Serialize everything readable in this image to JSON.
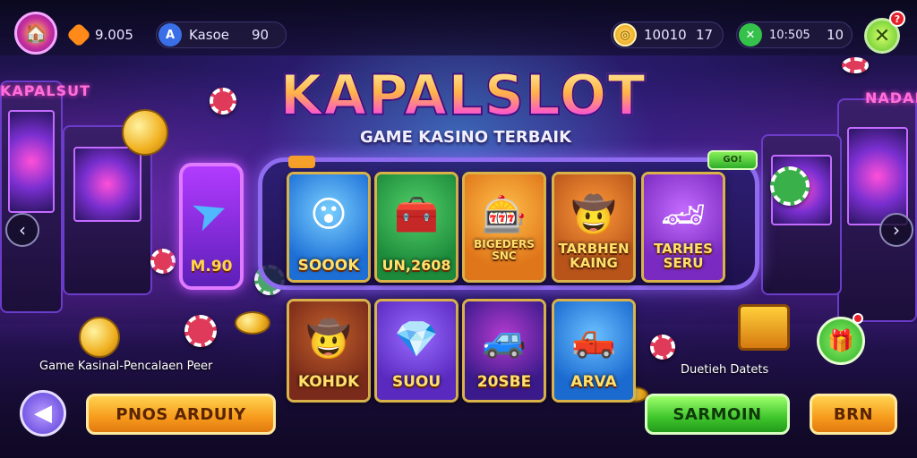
{
  "topbar": {
    "level_value": "9.005",
    "name_value": "Kasoe",
    "name_extra": "90",
    "coins_value": "10010",
    "coins_extra": "17",
    "cash_value": "10:505",
    "cash_extra": "10",
    "notification_count": "?"
  },
  "logo": {
    "title": "KAPALSLOT",
    "subtitle": "GAME KASINO TERBAIK"
  },
  "promo": {
    "value": "M.90"
  },
  "frame_tag_right": "GO!",
  "games_row1": [
    {
      "label": "SOOOK",
      "icon": "character-icon",
      "glyph": "😮",
      "bg": "#1d6fd6",
      "bg2": "#7ad0ff"
    },
    {
      "label": "UN,2608",
      "icon": "chest-icon",
      "glyph": "🧰",
      "bg": "#1c8a3a",
      "bg2": "#53d06a"
    },
    {
      "label": "BIGEDERS SNC",
      "icon": "slot-reel-icon",
      "glyph": "🎰",
      "bg": "#e0761a",
      "bg2": "#ffc04a"
    },
    {
      "label": "TARBHEN KAING",
      "icon": "pirate-icon",
      "glyph": "🤠",
      "bg": "#b8541a",
      "bg2": "#ff9a3a"
    },
    {
      "label": "TARHES SERU",
      "icon": "car-badge-icon",
      "glyph": "🏎",
      "bg": "#7a2ac0",
      "bg2": "#c46bff"
    }
  ],
  "games_row2": [
    {
      "label": "KOHDK",
      "icon": "cowboy-icon",
      "glyph": "🤠",
      "bg": "#7a2a1a",
      "bg2": "#c0602a"
    },
    {
      "label": "SUOU",
      "icon": "gem-icon",
      "glyph": "💎",
      "bg": "#5a2ac0",
      "bg2": "#9a6bff"
    },
    {
      "label": "20SBE",
      "icon": "truck-icon",
      "glyph": "🚙",
      "bg": "#3a1a8a",
      "bg2": "#b43bd0"
    },
    {
      "label": "ARVA",
      "icon": "red-truck-icon",
      "glyph": "🛻",
      "bg": "#1a6ad0",
      "bg2": "#6ac0ff"
    }
  ],
  "captions": {
    "left": "Game Kasinal-Pencalaen Peer",
    "right": "Duetieh Datets"
  },
  "buttons": {
    "left": "PNOS ARDUIY",
    "green": "SARMOIN",
    "right": "BRN"
  },
  "colors": {
    "accent": "#8f6bf0",
    "gold": "#ffd54a",
    "green": "#3fc52c",
    "orange": "#f79a1c"
  }
}
